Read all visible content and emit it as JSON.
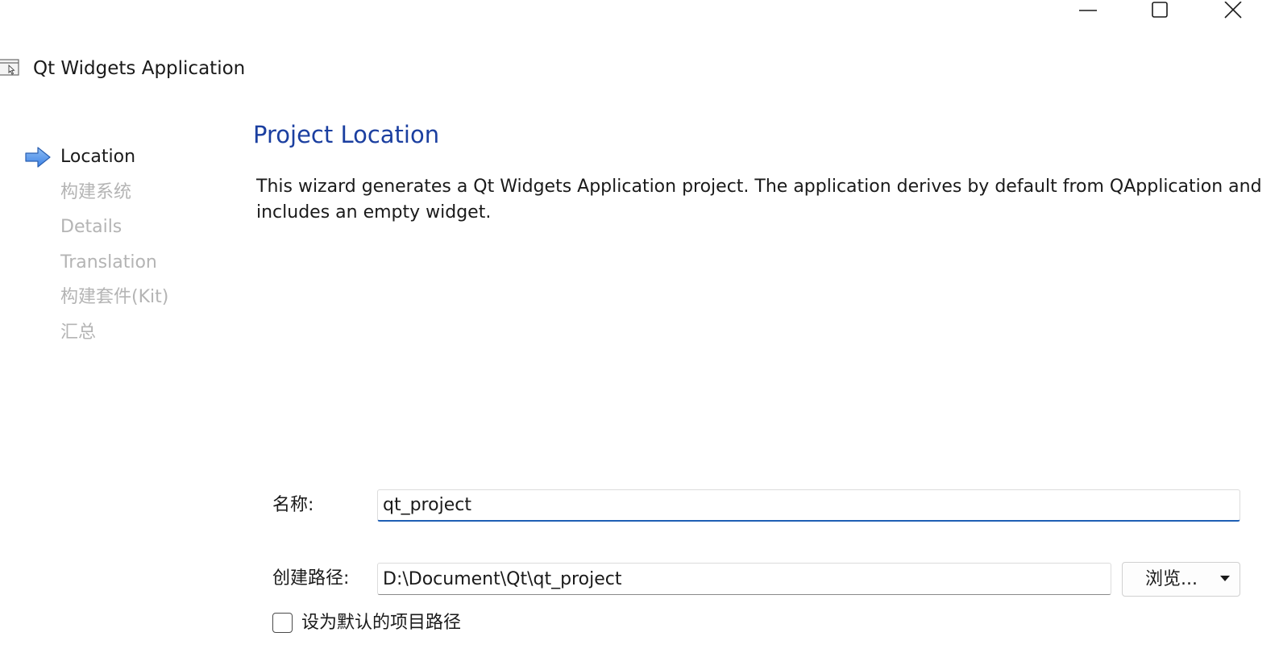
{
  "window": {
    "title": "Qt Widgets Application",
    "controls": [
      "minimize-icon",
      "maximize-icon",
      "close-icon"
    ]
  },
  "sidebar": {
    "current_index": 0,
    "items": [
      {
        "label": "Location"
      },
      {
        "label": "构建系统"
      },
      {
        "label": "Details"
      },
      {
        "label": "Translation"
      },
      {
        "label": "构建套件(Kit)"
      },
      {
        "label": "汇总"
      }
    ]
  },
  "main": {
    "title": "Project Location",
    "description": "This wizard generates a Qt Widgets Application project. The application derives by default from QApplication and includes an empty widget."
  },
  "form": {
    "name_label": "名称:",
    "name_value": "qt_project",
    "path_label": "创建路径:",
    "path_value": "D:\\Document\\Qt\\qt_project",
    "browse_label": "浏览...",
    "default_path_label": "设为默认的项目路径",
    "default_path_checked": false
  },
  "colors": {
    "title_blue": "#1b3fa0",
    "focus_underline": "#1e5fb4",
    "arrow_blue": "#3c82e6",
    "disabled_text": "#b4b4b4"
  }
}
